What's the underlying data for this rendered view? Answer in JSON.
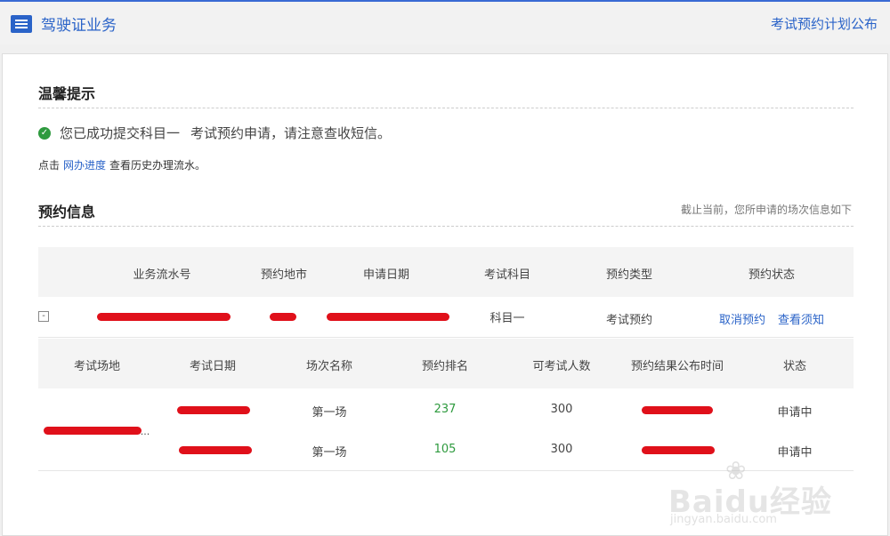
{
  "header": {
    "title": "驾驶证业务",
    "right_link": "考试预约计划公布"
  },
  "tips": {
    "title": "温馨提示",
    "message_a": "您已成功提交科目一",
    "message_b": "考试预约申请，请注意查收短信。",
    "hint_prefix": "点击",
    "hint_link": "网办进度",
    "hint_suffix": "查看历史办理流水。"
  },
  "booking": {
    "title": "预约信息",
    "note": "截止当前，您所申请的场次信息如下",
    "headers": [
      "业务流水号",
      "预约地市",
      "申请日期",
      "考试科目",
      "预约类型",
      "预约状态"
    ],
    "row": {
      "collapse": "-",
      "subject": "科目一",
      "type": "考试预约",
      "cancel": "取消预约",
      "view": "查看须知"
    },
    "sub_headers": [
      "考试场地",
      "考试日期",
      "场次名称",
      "预约排名",
      "可考试人数",
      "预约结果公布时间",
      "状态"
    ],
    "sub_rows": [
      {
        "session": "第一场",
        "rank": "237",
        "capacity": "300",
        "status": "申请中"
      },
      {
        "session": "第一场",
        "rank": "105",
        "capacity": "300",
        "status": "申请中"
      }
    ],
    "venue_suffix": "..."
  },
  "watermark": {
    "brand": "Baidu经验",
    "sub": "jingyan.baidu.com"
  },
  "colors": {
    "accent": "#2a63c8",
    "success": "#2e9a3e",
    "redaction": "#e0101a"
  }
}
